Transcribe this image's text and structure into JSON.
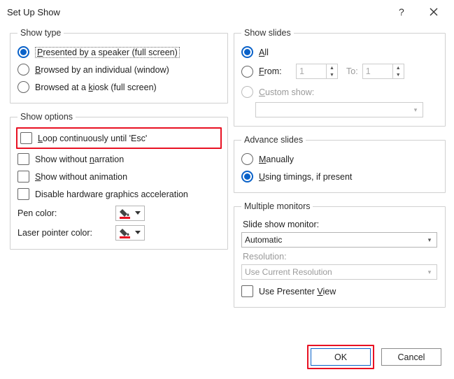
{
  "title": "Set Up Show",
  "groups": {
    "show_type": "Show type",
    "show_options": "Show options",
    "show_slides": "Show slides",
    "advance_slides": "Advance slides",
    "multiple_monitors": "Multiple monitors"
  },
  "show_type": {
    "presented": "Presented by a speaker (full screen)",
    "browsed_individual": "Browsed by an individual (window)",
    "browsed_kiosk": "Browsed at a kiosk (full screen)"
  },
  "show_options": {
    "loop": "Loop continuously until 'Esc'",
    "no_narration": "Show without narration",
    "no_animation": "Show without animation",
    "disable_hw": "Disable hardware graphics acceleration",
    "pen_color": "Pen color:",
    "laser_color": "Laser pointer color:"
  },
  "show_slides": {
    "all": "All",
    "from": "From:",
    "to": "To:",
    "from_val": "1",
    "to_val": "1",
    "custom": "Custom show:",
    "custom_val": ""
  },
  "advance": {
    "manually": "Manually",
    "timings": "Using timings, if present"
  },
  "monitors": {
    "monitor_label": "Slide show monitor:",
    "monitor_value": "Automatic",
    "resolution_label": "Resolution:",
    "resolution_value": "Use Current Resolution",
    "presenter_view": "Use Presenter View"
  },
  "buttons": {
    "ok": "OK",
    "cancel": "Cancel"
  }
}
